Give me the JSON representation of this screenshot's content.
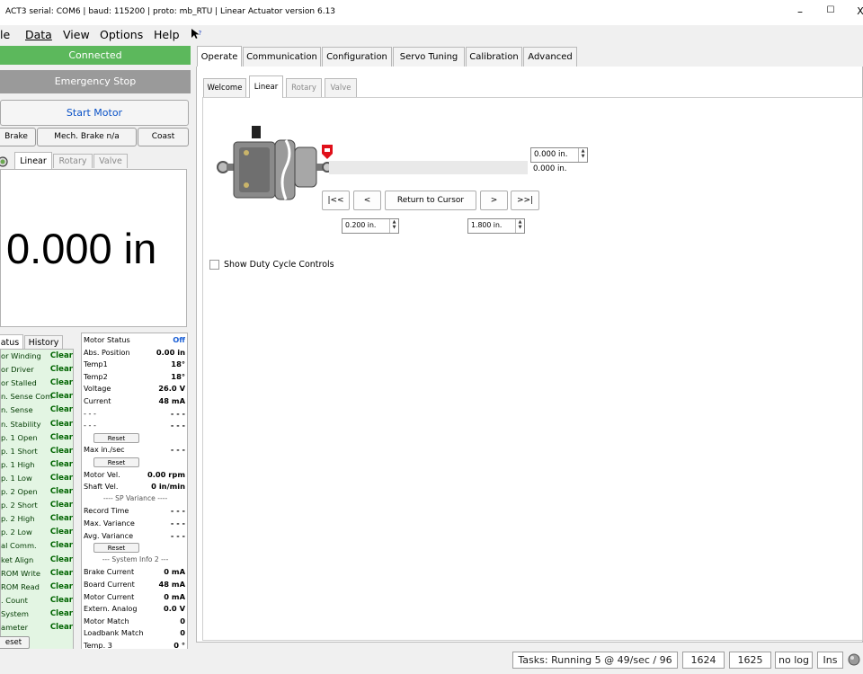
{
  "window": {
    "title": "ACT3  serial: COM6  |  baud: 115200  |  proto: mb_RTU  |  Linear Actuator version 6.13",
    "minimize": "–",
    "maximize": "☐",
    "close": "X"
  },
  "menu": [
    "le",
    "Data",
    "View",
    "Options",
    "Help"
  ],
  "left": {
    "connected": "Connected",
    "estop": "Emergency Stop",
    "start_motor": "Start Motor",
    "brake": "Brake",
    "mech_brake": "Mech. Brake n/a",
    "coast": "Coast",
    "tabs": [
      "Linear",
      "Rotary",
      "Valve"
    ],
    "position_display": "0.000 in",
    "status_tabs": [
      "atus",
      "History"
    ],
    "status_rows": [
      {
        "label": "or Winding",
        "value": "Clear"
      },
      {
        "label": "or Driver",
        "value": "Clear"
      },
      {
        "label": "or Stalled",
        "value": "Clear"
      },
      {
        "label": "n. Sense Com",
        "value": "Clear"
      },
      {
        "label": "n. Sense",
        "value": "Clear"
      },
      {
        "label": "n. Stability",
        "value": "Clear"
      },
      {
        "label": "p. 1 Open",
        "value": "Clear"
      },
      {
        "label": "p. 1 Short",
        "value": "Clear"
      },
      {
        "label": "p. 1 High",
        "value": "Clear"
      },
      {
        "label": "p. 1 Low",
        "value": "Clear"
      },
      {
        "label": "p. 2 Open",
        "value": "Clear"
      },
      {
        "label": "p. 2 Short",
        "value": "Clear"
      },
      {
        "label": "p. 2 High",
        "value": "Clear"
      },
      {
        "label": "p. 2 Low",
        "value": "Clear"
      },
      {
        "label": "al Comm.",
        "value": "Clear"
      },
      {
        "label": "ket Align",
        "value": "Clear"
      },
      {
        "label": "ROM Write",
        "value": "Clear"
      },
      {
        "label": "ROM Read",
        "value": "Clear"
      },
      {
        "label": ". Count",
        "value": "Clear"
      },
      {
        "label": "System",
        "value": "Clear"
      },
      {
        "label": "ameter",
        "value": "Clear"
      }
    ],
    "status_reset": "eset",
    "motor_status": {
      "rows_a": [
        {
          "label": "Motor Status",
          "value": "Off"
        },
        {
          "label": "Abs. Position",
          "value": "0.00 in"
        },
        {
          "label": "Temp1",
          "value": "18°"
        },
        {
          "label": "Temp2",
          "value": "18°"
        },
        {
          "label": "Voltage",
          "value": "26.0 V"
        },
        {
          "label": "Current",
          "value": "48 mA"
        },
        {
          "label": "- - -",
          "value": "- - -"
        },
        {
          "label": "- - -",
          "value": "- - -"
        }
      ],
      "reset1": "Reset",
      "max_in_sec": {
        "label": "Max in./sec",
        "value": "- - -"
      },
      "reset2": "Reset",
      "motor_vel": {
        "label": "Motor Vel.",
        "value": "0.00 rpm"
      },
      "shaft_vel": {
        "label": "Shaft Vel.",
        "value": "0 in/min"
      },
      "sp_variance": "---- SP Variance ----",
      "rows_b": [
        {
          "label": "Record Time",
          "value": "- - -"
        },
        {
          "label": "Max. Variance",
          "value": "- - -"
        },
        {
          "label": "Avg. Variance",
          "value": "- - -"
        }
      ],
      "reset3": "Reset",
      "system_info2": "--- System Info 2 ---",
      "rows_c": [
        {
          "label": "Brake Current",
          "value": "0 mA"
        },
        {
          "label": "Board Current",
          "value": "48 mA"
        },
        {
          "label": "Motor Current",
          "value": "0 mA"
        },
        {
          "label": "Extern. Analog",
          "value": "0.0 V"
        },
        {
          "label": "Motor Match",
          "value": "0"
        },
        {
          "label": "Loadbank Match",
          "value": "0"
        },
        {
          "label": "Temp. 3",
          "value": "0 °"
        }
      ]
    }
  },
  "main_tabs": [
    "Operate",
    "Communication",
    "Configuration",
    "Servo Tuning",
    "Calibration",
    "Advanced"
  ],
  "sub_tabs": [
    "Welcome",
    "Linear",
    "Rotary",
    "Valve"
  ],
  "linear": {
    "target_value": "0.000 in.",
    "actual_value": "0.000 in.",
    "nav_first": "|<<",
    "nav_prev": "<",
    "return_to_cursor": "Return to Cursor",
    "nav_next": ">",
    "nav_last": ">>|",
    "min_value": "0.200 in.",
    "max_value": "1.800 in.",
    "duty_cycle_label": "Show Duty Cycle Controls"
  },
  "statusbar": {
    "tasks": "Tasks: Running 5 @ 49/sec / 96",
    "val1": "1624",
    "val2": "1625",
    "log": "no log",
    "ins": "Ins"
  },
  "colors": {
    "connected_green": "#5cb85c",
    "estop_gray": "#9a9a9a",
    "start_blue_text": "#0a52c7",
    "clear_green": "#006400",
    "status_bg": "#e3f5e3",
    "cursor_red": "#e0101a"
  }
}
